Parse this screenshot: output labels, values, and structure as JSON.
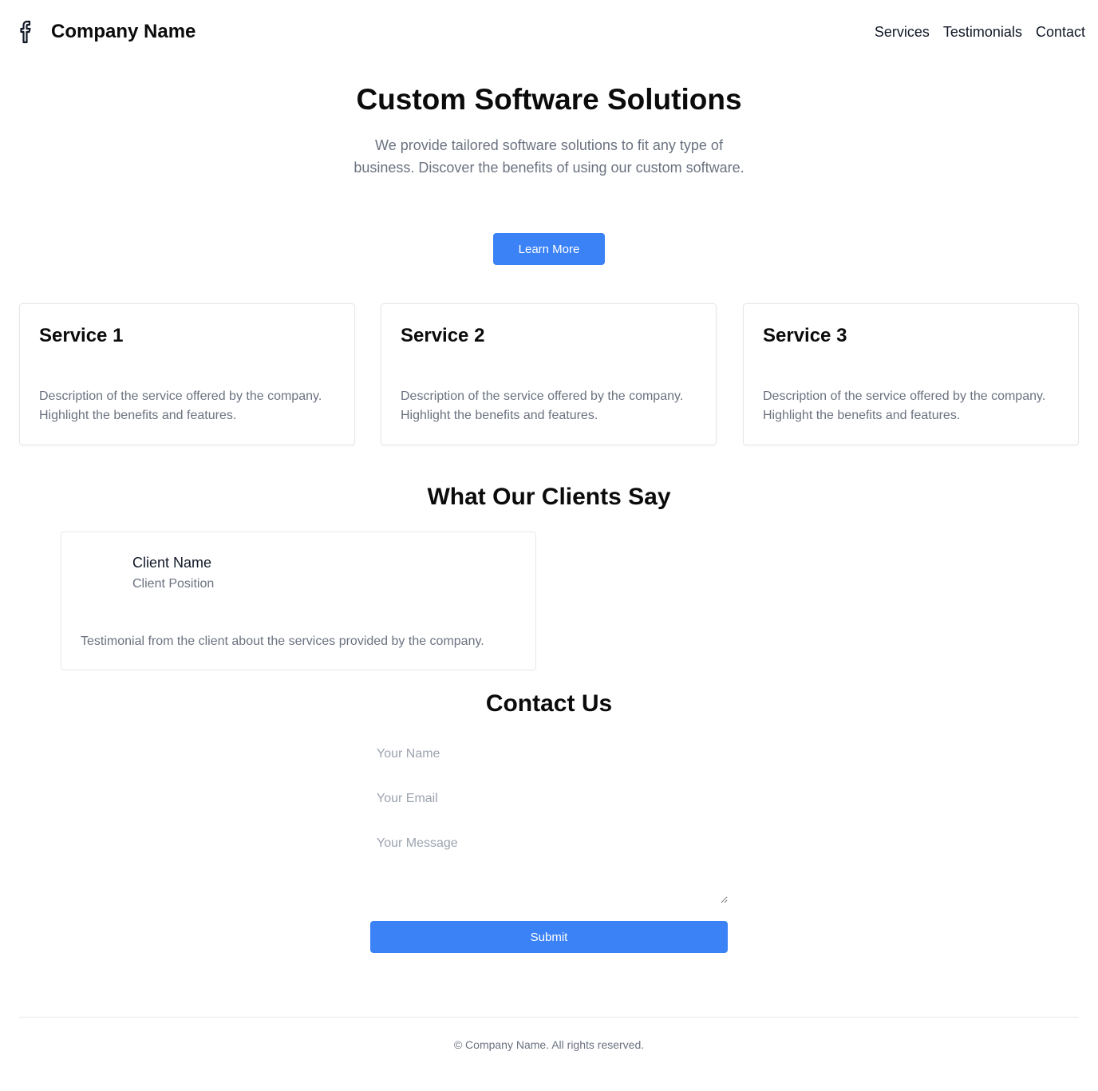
{
  "header": {
    "logo_icon": "facebook-icon",
    "brand": "Company Name",
    "nav": [
      "Services",
      "Testimonials",
      "Contact"
    ]
  },
  "hero": {
    "title": "Custom Software Solutions",
    "subtitle": "We provide tailored software solutions to fit any type of business. Discover the benefits of using our custom software.",
    "button_label": "Learn More"
  },
  "services": [
    {
      "title": "Service 1",
      "description": "Description of the service offered by the company. Highlight the benefits and features."
    },
    {
      "title": "Service 2",
      "description": "Description of the service offered by the company. Highlight the benefits and features."
    },
    {
      "title": "Service 3",
      "description": "Description of the service offered by the company. Highlight the benefits and features."
    }
  ],
  "testimonials": {
    "title": "What Our Clients Say",
    "items": [
      {
        "name": "Client Name",
        "position": "Client Position",
        "text": "Testimonial from the client about the services provided by the company."
      }
    ]
  },
  "contact": {
    "title": "Contact Us",
    "name_placeholder": "Your Name",
    "email_placeholder": "Your Email",
    "message_placeholder": "Your Message",
    "submit_label": "Submit"
  },
  "footer": {
    "text": "© Company Name. All rights reserved."
  },
  "colors": {
    "accent": "#3b82f6",
    "muted_text": "#6b7280",
    "border": "#e5e7eb"
  }
}
